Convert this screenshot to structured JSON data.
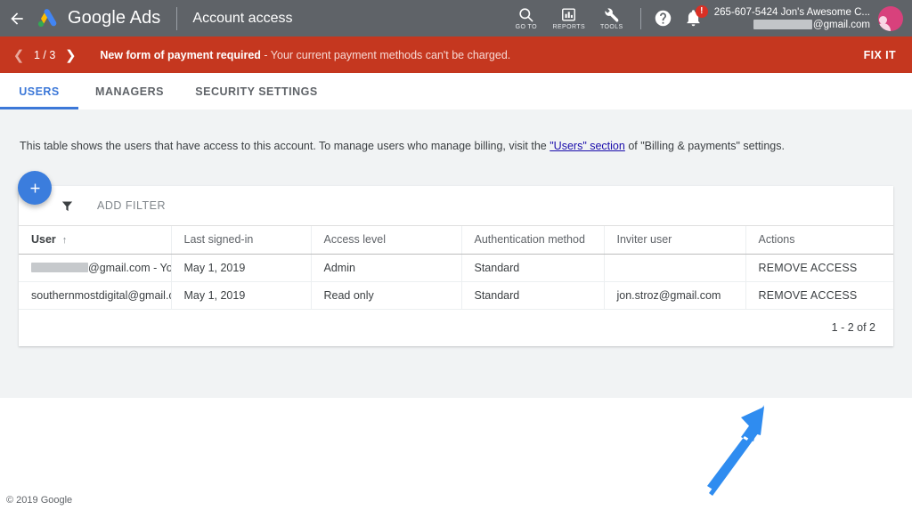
{
  "topbar": {
    "back_icon": "back-arrow-icon",
    "logo_icon": "google-ads-logo",
    "brand": "Google Ads",
    "page_title": "Account access",
    "tools": [
      {
        "icon": "search-icon",
        "label": "GO TO"
      },
      {
        "icon": "reports-bar-chart-icon",
        "label": "REPORTS"
      },
      {
        "icon": "wrench-tools-icon",
        "label": "TOOLS"
      }
    ],
    "help_icon": "help-question-icon",
    "notifications_icon": "notification-bell-icon",
    "notification_badge": "!",
    "account_id_name": "265-607-5424 Jon's Awesome C...",
    "account_email_suffix": "@gmail.com",
    "account_email_redacted": true,
    "avatar_icon": "user-avatar"
  },
  "banner": {
    "prev_icon": "chevron-left-icon",
    "counter": "1 / 3",
    "next_icon": "chevron-right-icon",
    "title": "New form of payment required",
    "message": " - Your current payment methods can't be charged.",
    "action_label": "FIX IT",
    "background_color": "#c5371f"
  },
  "tabs": [
    {
      "label": "USERS",
      "active": true
    },
    {
      "label": "MANAGERS",
      "active": false
    },
    {
      "label": "SECURITY SETTINGS",
      "active": false
    }
  ],
  "content": {
    "description_part1": "This table shows the users that have access to this account. To manage users who manage billing, visit the ",
    "description_link": "\"Users\" section",
    "description_part2": " of \"Billing & payments\" settings.",
    "add_button_icon": "plus-icon",
    "filter_icon": "funnel-filter-icon",
    "add_filter_label": "ADD FILTER"
  },
  "table": {
    "columns": [
      "User",
      "Last signed-in",
      "Access level",
      "Authentication method",
      "Inviter user",
      "Actions"
    ],
    "sort_column": "User",
    "sort_direction_icon": "arrow-up-icon",
    "rows": [
      {
        "user_redacted": true,
        "user": "@gmail.com - You",
        "last_signed_in": "May 1, 2019",
        "access_level": "Admin",
        "authentication_method": "Standard",
        "inviter_user": "",
        "action": "REMOVE ACCESS"
      },
      {
        "user_redacted": false,
        "user": "southernmostdigital@gmail.com",
        "last_signed_in": "May 1, 2019",
        "access_level": "Read only",
        "authentication_method": "Standard",
        "inviter_user": "jon.stroz@gmail.com",
        "action": "REMOVE ACCESS"
      }
    ],
    "pagination": "1 - 2 of 2"
  },
  "annotation": {
    "type": "arrow",
    "color": "#2f8cf0",
    "points_to": "REMOVE ACCESS (row 2)"
  },
  "footer": {
    "copyright": "© 2019 Google"
  },
  "colors": {
    "topbar": "#5f6368",
    "banner": "#c5371f",
    "accent_blue": "#3c78d8",
    "fab_blue": "#3b7ddd",
    "page_bg": "#f1f3f4",
    "link": "#1a0dab"
  }
}
